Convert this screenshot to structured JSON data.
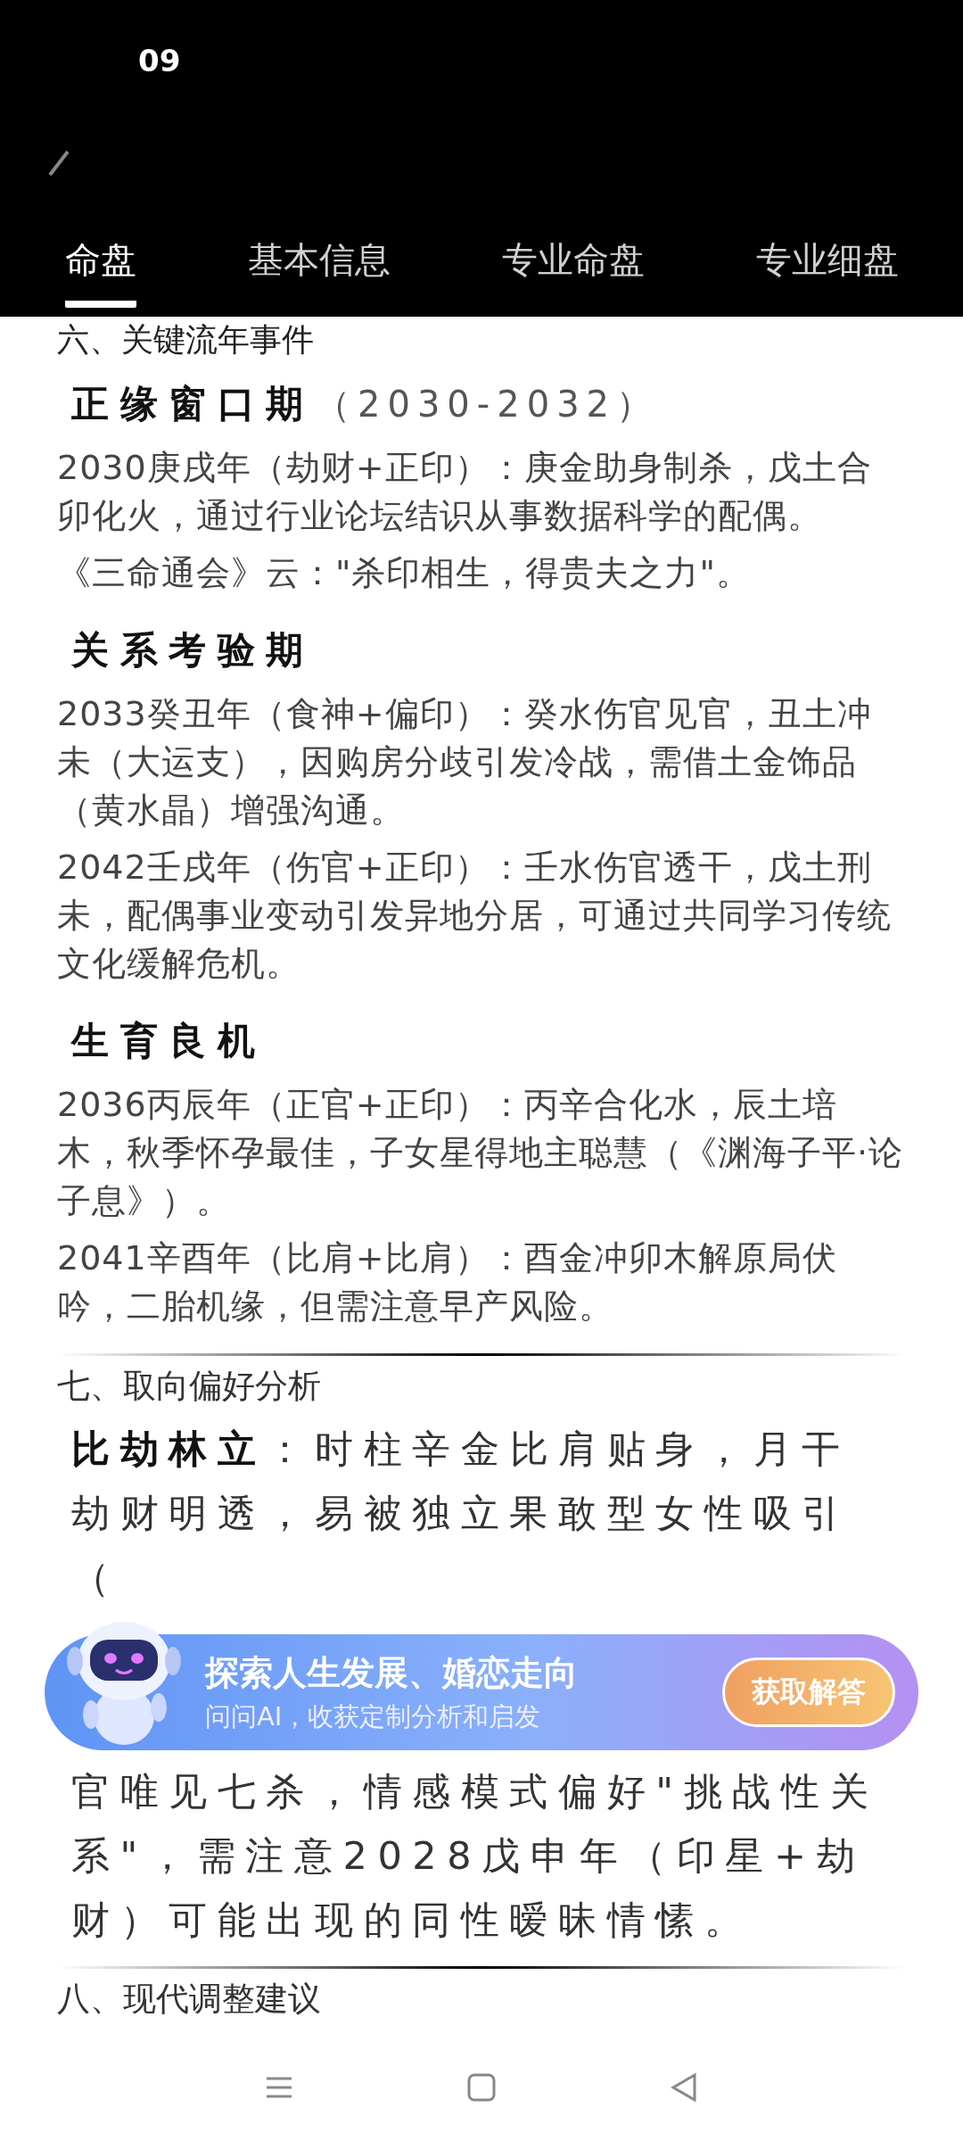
{
  "status_bar": {
    "time": "09"
  },
  "tabs": [
    {
      "label": "命盘",
      "selected": true
    },
    {
      "label": "基本信息",
      "selected": false
    },
    {
      "label": "专业命盘",
      "selected": false
    },
    {
      "label": "专业细盘",
      "selected": false
    }
  ],
  "cut_section_title": "六、关键流年事件",
  "periods": [
    {
      "title": "正缘窗口期",
      "note": "（2030-2032）",
      "paragraphs": [
        "2030庚戌年（劫财+正印）：庚金助身制杀，戊土合卯化火，通过行业论坛结识从事数据科学的配偶。",
        "《三命通会》云：\"杀印相生，得贵夫之力\"。"
      ]
    },
    {
      "title": "关系考验期",
      "paragraphs": [
        "2033癸丑年（食神+偏印）：癸水伤官见官，丑土冲未（大运支），因购房分歧引发冷战，需借土金饰品（黄水晶）增强沟通。",
        "2042壬戌年（伤官+正印）：壬水伤官透干，戊土刑未，配偶事业变动引发异地分居，可通过共同学习传统文化缓解危机。"
      ]
    },
    {
      "title": "生育良机",
      "paragraphs": [
        "2036丙辰年（正官+正印）：丙辛合化水，辰土培木，秋季怀孕最佳，子女星得地主聪慧（《渊海子平·论子息》）。",
        "2041辛酉年（比肩+比肩）：酉金冲卯木解原局伏吟，二胎机缘，但需注意早产风险。"
      ]
    }
  ],
  "section_title": "七、取向偏好分析",
  "analysis": {
    "before": "**比劫林立**：时柱辛金比肩贴身，月干劫财明透，易被独立果敢型女性吸引",
    "fragment": "（",
    "after": "官唯见七杀，情感模式偏好\"挑战性关系\"，需注意2028戊申年（印星+劫财）可能出现的同性暧昧情愫。"
  },
  "next_section_title": "八、现代调整建议",
  "banner": {
    "title": "探索人生发展、婚恋走向",
    "subtitle": "问问AI，收获定制分析和启发",
    "button": "获取解答"
  }
}
